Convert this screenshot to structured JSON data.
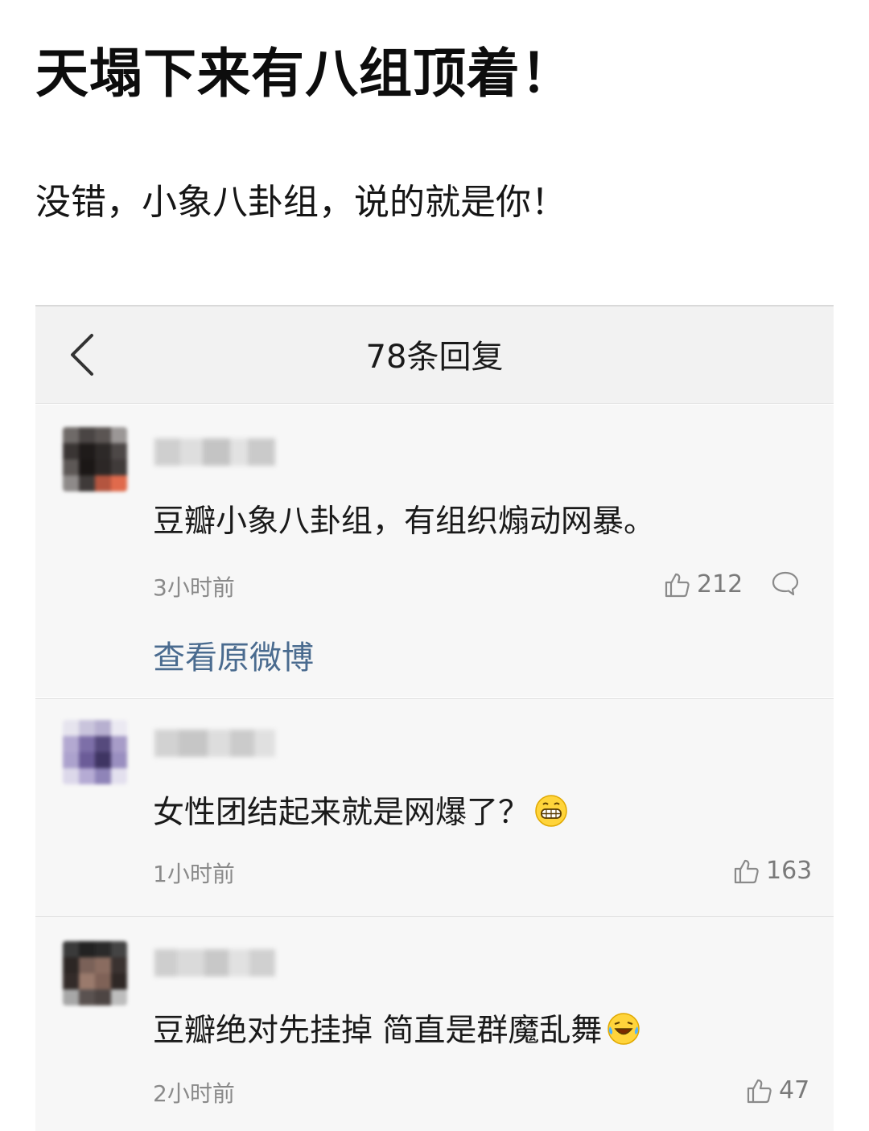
{
  "article": {
    "headline": "天塌下来有八组顶着！",
    "subline": "没错，小象八卦组，说的就是你！"
  },
  "screenshot": {
    "title": "78条回复",
    "comments": [
      {
        "text": "豆瓣小象八卦组，有组织煽动网暴。",
        "time": "3小时前",
        "likes": "212",
        "link": "查看原微博"
      },
      {
        "text": "女性团结起来就是网爆了？",
        "emoji": "grinning-face-emoji",
        "time": "1小时前",
        "likes": "163"
      },
      {
        "text": "豆瓣绝对先挂掉 简直是群魔乱舞",
        "emoji": "laughing-tears-emoji",
        "time": "2小时前",
        "likes": "47"
      }
    ]
  },
  "colors": {
    "link": "#4a6b8f",
    "meta": "#8a8a8a",
    "card_bg": "#f7f7f7",
    "header_bg": "#f2f2f2"
  },
  "icons": [
    "chevron-left-icon",
    "thumbs-up-icon",
    "reply-bubble-icon"
  ]
}
